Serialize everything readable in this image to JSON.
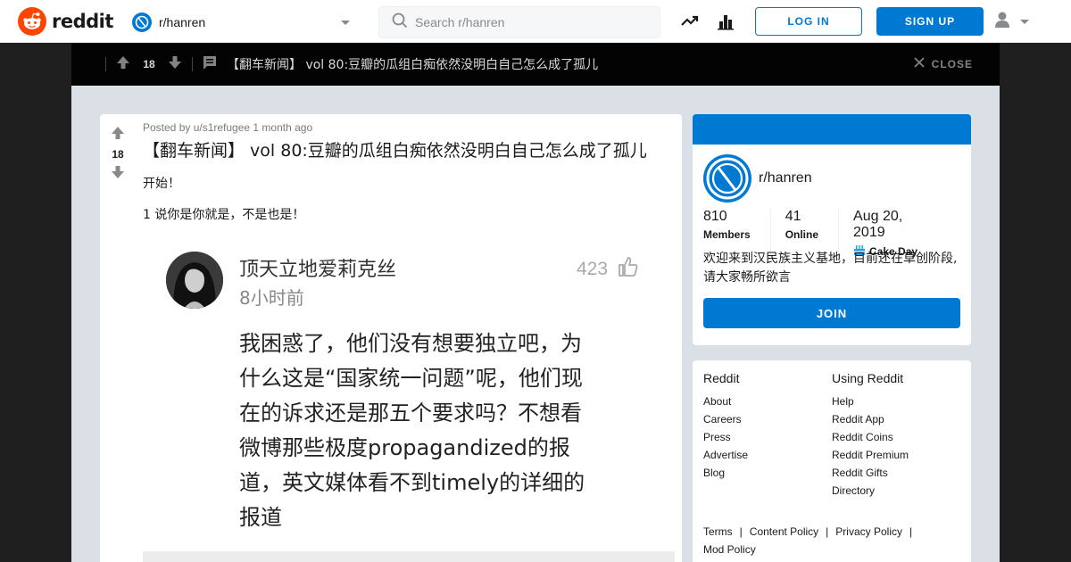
{
  "header": {
    "logo_text": "reddit",
    "subreddit": "r/hanren",
    "search_placeholder": "Search r/hanren",
    "login_label": "LOG IN",
    "signup_label": "SIGN UP"
  },
  "postbar": {
    "votes": "18",
    "title": "【翻车新闻】 vol 80:豆瓣的瓜组白痴依然没明白自己怎么成了孤儿",
    "close_label": "CLOSE"
  },
  "post": {
    "votes": "18",
    "meta": "Posted by u/s1refugee 1 month ago",
    "title": "【翻车新闻】 vol 80:豆瓣的瓜组白痴依然没明白自己怎么成了孤儿",
    "para1": "开始！",
    "para2": "1 说你是你就是，不是也是！",
    "embed": {
      "name": "顶天立地爱莉克丝",
      "time": "8小时前",
      "likes": "423",
      "lines": [
        "我困惑了，他们没有想要独立吧，为",
        "什么这是“国家统一问题”呢，他们现",
        "在的诉求还是那五个要求吗？不想看",
        "微博那些极度propagandized的报",
        "道，英文媒体看不到timely的详细的",
        "报道"
      ]
    }
  },
  "sidebar": {
    "subreddit": "r/hanren",
    "members_value": "810",
    "members_label": "Members",
    "online_value": "41",
    "online_label": "Online",
    "cake_value": "Aug 20, 2019",
    "cake_label": "Cake Day",
    "description": "欢迎来到汉民族主义基地，目前还在草创阶段,请大家畅所欲言",
    "join_label": "JOIN"
  },
  "footer": {
    "col1_title": "Reddit",
    "col1_links": [
      "About",
      "Careers",
      "Press",
      "Advertise",
      "Blog"
    ],
    "col2_title": "Using Reddit",
    "col2_links": [
      "Help",
      "Reddit App",
      "Reddit Coins",
      "Reddit Premium",
      "Reddit Gifts",
      "Directory"
    ],
    "legal": [
      "Terms",
      "Content Policy",
      "Privacy Policy",
      "Mod Policy"
    ]
  },
  "colors": {
    "brand_orange": "#ff4500",
    "accent_blue": "#0079d3",
    "postbar_bg": "#030303",
    "page_bg": "#dae0e6"
  },
  "icons": [
    "reddit-logo-icon",
    "subreddit-icon",
    "chevron-down-icon",
    "search-icon",
    "trending-icon",
    "stats-icon",
    "user-icon",
    "upvote-icon",
    "downvote-icon",
    "comment-icon",
    "close-icon",
    "thumbs-up-icon",
    "cake-icon"
  ]
}
